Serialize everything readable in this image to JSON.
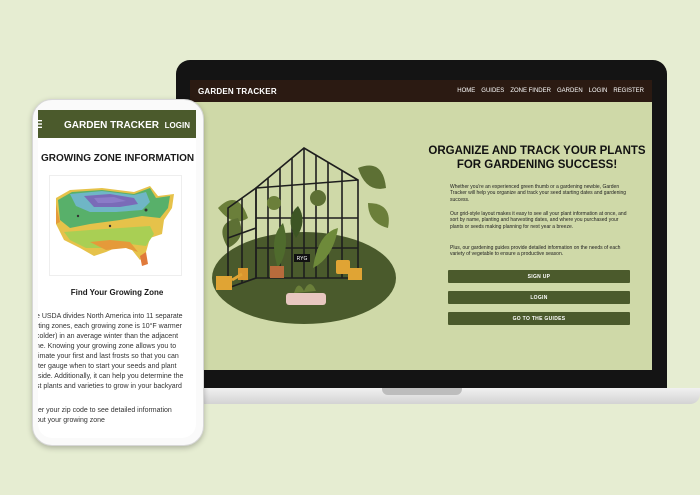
{
  "desktop": {
    "nav": {
      "logo": "GARDEN TRACKER",
      "links": [
        "HOME",
        "GUIDES",
        "ZONE FINDER",
        "GARDEN",
        "LOGIN",
        "REGISTER"
      ]
    },
    "hero": {
      "title_line1": "ORGANIZE AND TRACK YOUR PLANTS",
      "title_line2": "FOR GARDENING SUCCESS!",
      "paragraph1": "Whether you're an experienced green thumb or a gardening newbie, Garden Tracker will help you organize and track your seed starting dates and gardening success.",
      "paragraph2": "Our grid-style layout makes it easy to see all your plant information at once, and sort by name, planting and harvesting dates, and where you purchased your plants or seeds making planning for next year a breeze.",
      "paragraph3": "Plus, our gardening guides provide detailed information on the needs of each variety of vegetable to ensure a productive season.",
      "buttons": {
        "signup": "SIGN UP",
        "login": "LOGIN",
        "guides": "GO TO THE GUIDES"
      },
      "sign_text": "RYG"
    }
  },
  "mobile": {
    "nav": {
      "logo": "GARDEN TRACKER",
      "login": "LOGIN"
    },
    "heading": "GROWING ZONE INFORMATION",
    "subheading": "Find Your Growing Zone",
    "body_lines": [
      "e USDA divides North America into 11 separate",
      "rting zones, each growing zone is 10°F warmer",
      "colder) in an average winter than the adjacent",
      "ne. Knowing your growing zone allows you to",
      "timate your first and last frosts so that you can",
      "tter gauge when to start your seeds and plant",
      "tside. Additionally, it can help you determine the",
      "st plants and varieties to grow in your backyard"
    ],
    "zip_lines": [
      "ter your zip code to see detailed information",
      "out your growing zone"
    ]
  },
  "colors": {
    "page_bg": "#e6edd2",
    "site_bg": "#cfd9a8",
    "nav_dark": "#2b1a12",
    "accent_green": "#4b5a2c"
  }
}
